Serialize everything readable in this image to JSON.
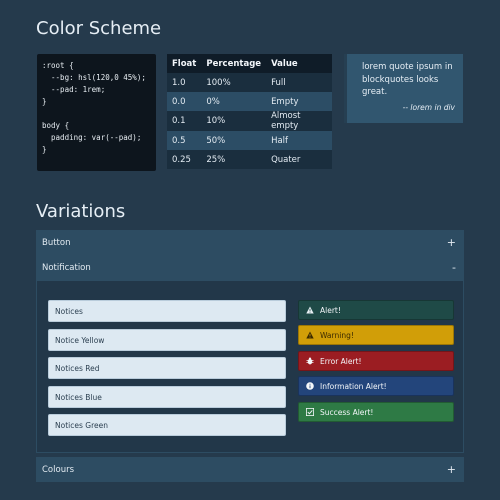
{
  "headings": {
    "color_scheme": "Color Scheme",
    "variations": "Variations"
  },
  "code_block": [
    ":root {",
    "  --bg: hsl(120,0 45%);",
    "  --pad: 1rem;",
    "}",
    "",
    "body {",
    "  padding: var(--pad);",
    "}"
  ],
  "table": {
    "headers": [
      "Float",
      "Percentage",
      "Value"
    ],
    "rows": [
      [
        "1.0",
        "100%",
        "Full"
      ],
      [
        "0.0",
        "0%",
        "Empty"
      ],
      [
        "0.1",
        "10%",
        "Almost empty"
      ],
      [
        "0.5",
        "50%",
        "Half"
      ],
      [
        "0.25",
        "25%",
        "Quater"
      ]
    ]
  },
  "blockquote": {
    "text": "lorem quote ipsum in blockquotes looks great.",
    "cite": "-- lorem in div"
  },
  "accordion": [
    {
      "label": "Button",
      "sign": "+"
    },
    {
      "label": "Notification",
      "sign": "-"
    },
    {
      "label": "Colours",
      "sign": "+"
    }
  ],
  "notices": [
    "Notices",
    "Notice Yellow",
    "Notices Red",
    "Notices Blue",
    "Notices Green"
  ],
  "alerts": [
    {
      "label": "Alert!",
      "icon": "warning-icon",
      "color": "#1f4a47"
    },
    {
      "label": "Warning!",
      "icon": "warning-icon",
      "color": "#d19e08"
    },
    {
      "label": "Error Alert!",
      "icon": "bug-icon",
      "color": "#9b1d22"
    },
    {
      "label": "Information Alert!",
      "icon": "info-icon",
      "color": "#23457b"
    },
    {
      "label": "Success Alert!",
      "icon": "check-square-icon",
      "color": "#2e7a45"
    }
  ]
}
